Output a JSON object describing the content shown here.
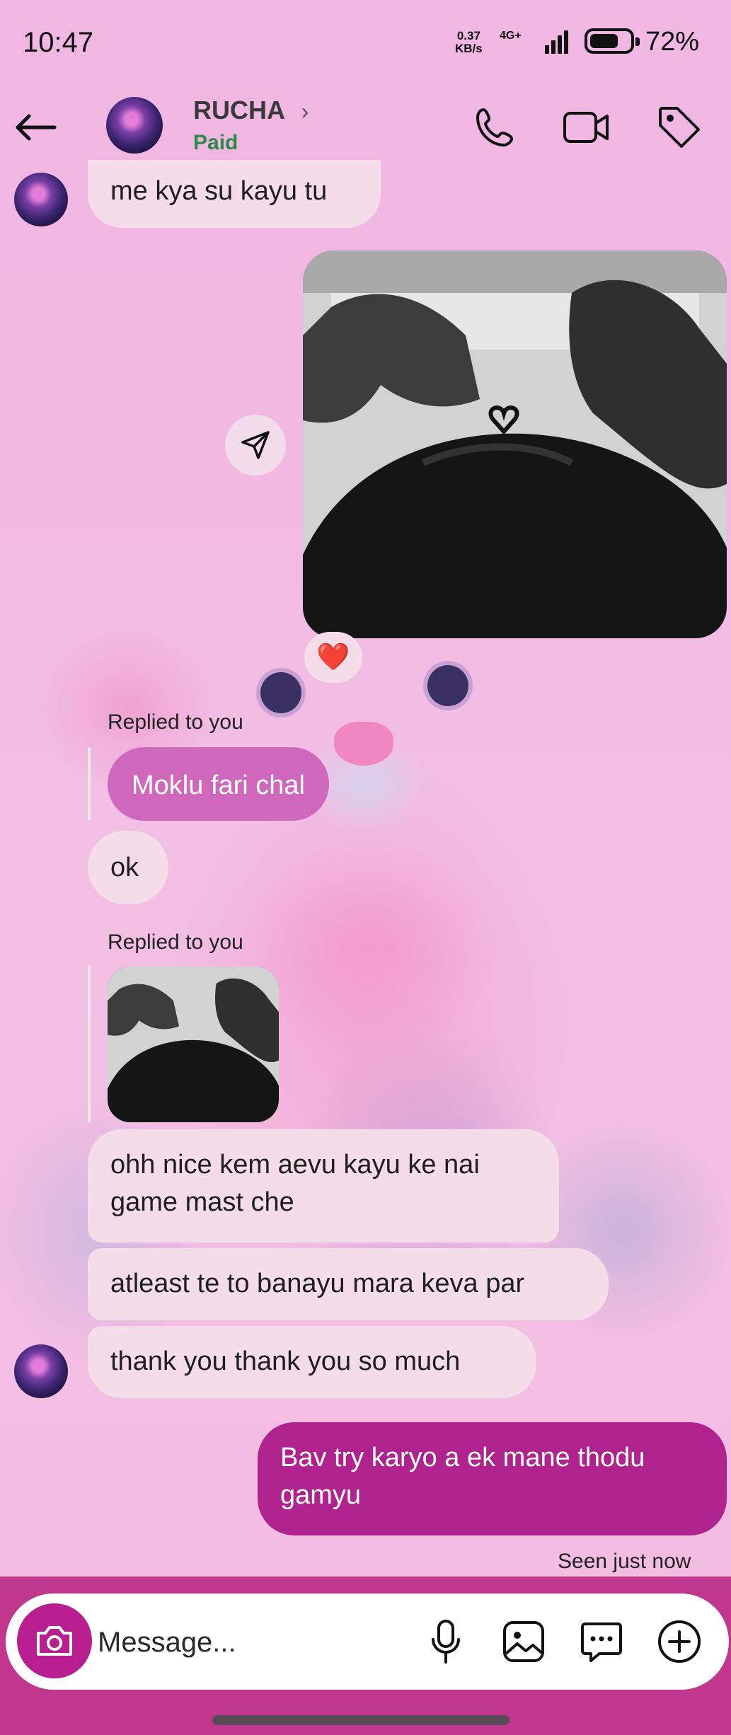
{
  "status_bar": {
    "time": "10:47",
    "speed_value": "0.37",
    "speed_unit": "KB/s",
    "network": "4G+",
    "battery_percent": "72%",
    "battery_level": 0.72
  },
  "header": {
    "contact_name": "RUCHA",
    "contact_status": "Paid",
    "icons": [
      "back-arrow-icon",
      "phone-icon",
      "video-camera-icon",
      "tag-icon"
    ]
  },
  "messages": [
    {
      "from": "them",
      "type": "text",
      "text": "me kya su kayu tu"
    },
    {
      "from": "me",
      "type": "photo",
      "description_icon": "share-icon",
      "reaction": "❤️"
    },
    {
      "from": "them",
      "type": "reply",
      "reply_label": "Replied to you",
      "quoted_text": "Moklu fari chal"
    },
    {
      "from": "them",
      "type": "text",
      "text": "ok"
    },
    {
      "from": "them",
      "type": "reply_photo",
      "reply_label": "Replied to you"
    },
    {
      "from": "them",
      "type": "text",
      "text": "ohh nice kem aevu kayu ke nai game mast che"
    },
    {
      "from": "them",
      "type": "text",
      "text": "atleast te to banayu mara keva par"
    },
    {
      "from": "them",
      "type": "text",
      "text": "thank you thank you so much"
    },
    {
      "from": "me",
      "type": "text",
      "text": "Bav try karyo a ek mane thodu gamyu"
    }
  ],
  "seen_text": "Seen just now",
  "composer": {
    "placeholder": "Message...",
    "icons": [
      "camera-icon",
      "microphone-icon",
      "gallery-icon",
      "sticker-chat-icon",
      "add-icon"
    ]
  },
  "colors": {
    "background": "#f0b7e3",
    "my_bubble": "#b0238f",
    "their_bubble": "#f4dde9",
    "quoted_bubble": "#cf67bd",
    "paid_status": "#2a8a46"
  }
}
